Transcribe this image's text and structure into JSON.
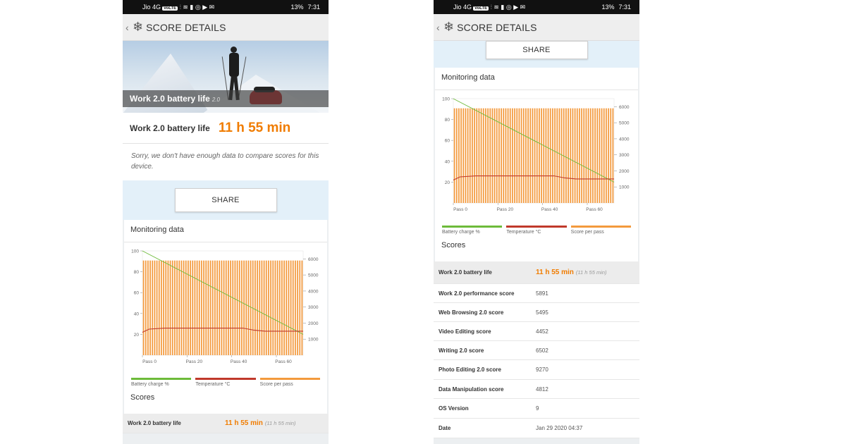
{
  "status": {
    "carrier": "Jio 4G",
    "badge": "VoLTE",
    "icons": "⫶ ≋ ▮ ◎ ▶ ✉",
    "battery": "13%",
    "time": "7:31"
  },
  "appbar": {
    "title": "SCORE DETAILS"
  },
  "hero": {
    "label": "Work 2.0 battery life",
    "version": "2.0"
  },
  "headline": {
    "label": "Work 2.0 battery life",
    "value": "11 h 55 min"
  },
  "sorry_text": "Sorry, we don't have enough data to compare scores for this device.",
  "share_label": "SHARE",
  "monitoring": {
    "title": "Monitoring data"
  },
  "colors": {
    "accent": "#f07c00",
    "battery": "#6dbb3a",
    "temperature": "#c0392b",
    "score": "#f39a3d"
  },
  "chart_data": {
    "type": "bar",
    "x_ticks": [
      "Pass 0",
      "Pass 20",
      "Pass 40",
      "Pass 60"
    ],
    "y_left_ticks": [
      "100",
      "80",
      "60",
      "40",
      "20"
    ],
    "y_right_ticks": [
      "6000",
      "5000",
      "4000",
      "3000",
      "2000",
      "1000"
    ],
    "ylim_left": [
      0,
      100
    ],
    "ylim_right": [
      0,
      6500
    ],
    "passes": 72,
    "series": [
      {
        "name": "Battery charge %",
        "type": "line",
        "x": [
          0,
          72
        ],
        "values": [
          100,
          20
        ]
      },
      {
        "name": "Temperature °C",
        "type": "line",
        "x": [
          0,
          3,
          10,
          45,
          50,
          55,
          60,
          65,
          72
        ],
        "values": [
          22,
          25,
          26,
          26,
          24,
          23,
          23,
          23,
          23
        ]
      },
      {
        "name": "Score per pass",
        "type": "bar",
        "value": 5900
      }
    ],
    "legend": [
      "Battery charge %",
      "Temperature °C",
      "Score per pass"
    ]
  },
  "scores": {
    "title": "Scores",
    "rows": [
      {
        "label": "Work 2.0 battery life",
        "value": "11 h 55 min",
        "sub": "(11 h 55 min)"
      },
      {
        "label": "Work 2.0 performance score",
        "value": "5891"
      },
      {
        "label": "Web Browsing 2.0 score",
        "value": "5495"
      },
      {
        "label": "Video Editing score",
        "value": "4452"
      },
      {
        "label": "Writing 2.0 score",
        "value": "6502"
      },
      {
        "label": "Photo Editing 2.0 score",
        "value": "9270"
      },
      {
        "label": "Data Manipulation score",
        "value": "4812"
      },
      {
        "label": "OS Version",
        "value": "9"
      },
      {
        "label": "Date",
        "value": "Jan 29 2020 04:37"
      }
    ]
  }
}
